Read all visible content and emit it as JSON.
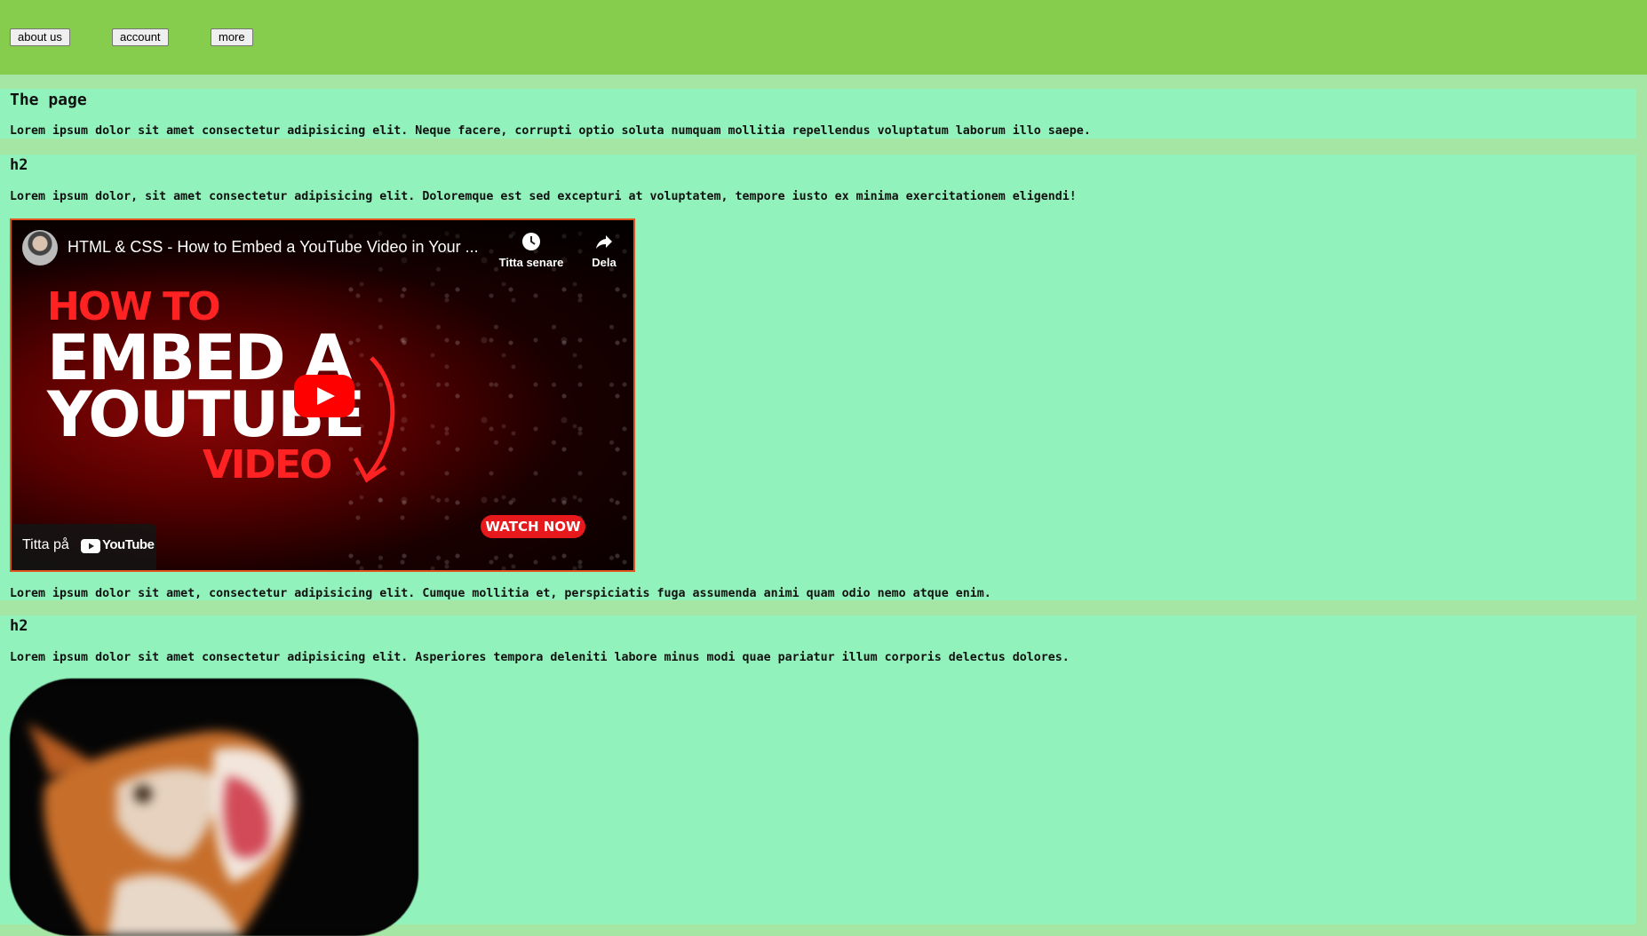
{
  "nav": {
    "about_label": "about us",
    "account_label": "account",
    "more_label": "more"
  },
  "section1": {
    "heading": "The page",
    "text": "Lorem ipsum dolor sit amet consectetur adipisicing elit. Neque facere, corrupti optio soluta numquam mollitia repellendus voluptatum laborum illo saepe."
  },
  "section2": {
    "heading": "h2",
    "text_above": "Lorem ipsum dolor, sit amet consectetur adipisicing elit. Doloremque est sed excepturi at voluptatem, tempore iusto ex minima exercitationem eligendi!",
    "text_below": "Lorem ipsum dolor sit amet, consectetur adipisicing elit. Cumque mollitia et, perspiciatis fuga assumenda animi quam odio nemo atque enim."
  },
  "video": {
    "title": "HTML & CSS - How to Embed a YouTube Video in Your ...",
    "watch_later": "Titta senare",
    "share": "Dela",
    "thumb_line1": "HOW TO",
    "thumb_line2": "EMBED A",
    "thumb_line3": "YOUTUBE",
    "thumb_line4": "VIDEO",
    "watch_now": "WATCH NOW",
    "watch_on": "Titta på",
    "youtube_brand": "YouTube"
  },
  "section3": {
    "heading": "h2",
    "text": "Lorem ipsum dolor sit amet consectetur adipisicing elit. Asperiores tempora deleniti labore minus modi quae pariatur illum corporis delectus dolores."
  },
  "colors": {
    "header_bg": "#86cd4e",
    "page_bg": "#a6e6a4",
    "section_bg": "#92f2bc",
    "video_border": "#e0531f",
    "youtube_red": "#ff0000"
  }
}
